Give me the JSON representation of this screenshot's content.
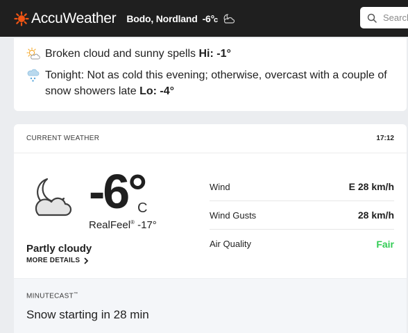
{
  "header": {
    "brand": "AccuWeather",
    "location": "Bodo, Nordland",
    "temp": "-6°",
    "unit": "c",
    "search_placeholder": "Search"
  },
  "forecast": {
    "today": {
      "text": "Broken cloud and sunny spells",
      "label": "Hi:",
      "value": "-1°",
      "icon": "sun-cloud-icon"
    },
    "tonight": {
      "text": "Tonight: Not as cold this evening; otherwise, overcast with a couple of snow showers late",
      "label": "Lo:",
      "value": "-4°",
      "icon": "snow-cloud-icon"
    }
  },
  "current": {
    "title": "CURRENT WEATHER",
    "time": "17:12",
    "temp": "-6°",
    "unit": "C",
    "realfeel_label": "RealFeel",
    "realfeel_mark": "®",
    "realfeel_value": "-17°",
    "phrase": "Partly cloudy",
    "more_details": "MORE DETAILS",
    "icon": "moon-cloud-icon",
    "details": [
      {
        "label": "Wind",
        "value": "E 28 km/h"
      },
      {
        "label": "Wind Gusts",
        "value": "28 km/h"
      },
      {
        "label": "Air Quality",
        "value": "Fair"
      }
    ],
    "air_quality_color": "#33cc55"
  },
  "minutecast": {
    "title": "MINUTECAST",
    "mark": "™",
    "text": "Snow starting in 28 min"
  }
}
